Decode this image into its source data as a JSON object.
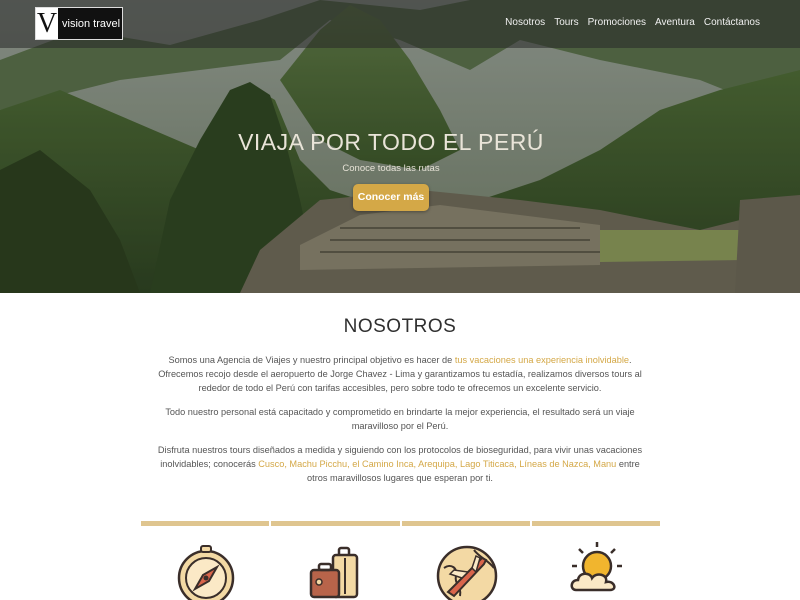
{
  "brand": {
    "mark": "V",
    "name": "vision travel"
  },
  "nav": [
    "Nosotros",
    "Tours",
    "Promociones",
    "Aventura",
    "Contáctanos"
  ],
  "hero": {
    "title": "VIAJA POR TODO EL PERÚ",
    "subtitle": "Conoce todas las rutas",
    "cta": "Conocer más"
  },
  "about": {
    "title": "NOSOTROS",
    "p1_a": "Somos una Agencia de Viajes y nuestro principal objetivo es hacer de ",
    "p1_hl": "tus vacaciones una experiencia inolvidable",
    "p1_b": ". Ofrecemos recojo desde el aeropuerto de Jorge Chavez - Lima y garantizamos tu estadía, realizamos diversos tours al rededor de todo el Perú con tarifas accesibles, pero sobre todo te ofrecemos un excelente servicio.",
    "p2": "Todo nuestro personal está capacitado y comprometido en brindarte la mejor experiencia, el resultado será un viaje maravilloso por el Perú.",
    "p3_a": "Disfruta nuestros tours diseñados a medida y siguiendo con los protocolos de bioseguridad, para vivir unas vacaciones inolvidables; conocerás ",
    "p3_hl": "Cusco, Machu Picchu, el Camino Inca, Arequipa, Lago Titicaca, Líneas de Nazca, Manu",
    "p3_b": " entre otros maravillosos lugares que esperan por ti."
  },
  "cards": [
    {
      "icon": "compass-icon"
    },
    {
      "icon": "luggage-icon"
    },
    {
      "icon": "globe-plane-icon"
    },
    {
      "icon": "sun-cloud-icon"
    }
  ],
  "colors": {
    "accent": "#d4a847",
    "card_border": "#dfc58f",
    "heading": "#2f2f2f"
  }
}
